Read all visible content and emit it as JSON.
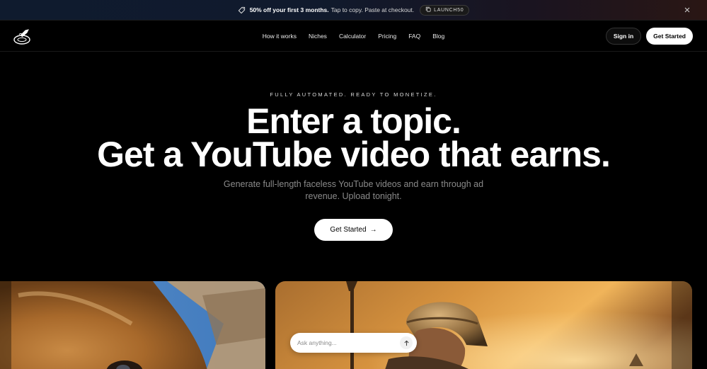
{
  "banner": {
    "offer": "50% off your first 3 months.",
    "instructions": "Tap to copy. Paste at checkout.",
    "code": "LAUNCH50"
  },
  "nav": {
    "links": [
      "How it works",
      "Niches",
      "Calculator",
      "Pricing",
      "FAQ",
      "Blog"
    ],
    "sign_in": "Sign in",
    "get_started": "Get Started"
  },
  "hero": {
    "eyebrow": "FULLY AUTOMATED. READY TO MONETIZE.",
    "headline_line1": "Enter a topic.",
    "headline_line2": "Get a YouTube video that earns.",
    "subtitle_line1": "Generate full-length faceless YouTube videos and earn through ad",
    "subtitle_line2": "revenue. Upload tonight.",
    "cta": "Get Started",
    "cta_arrow": "→"
  },
  "ask": {
    "placeholder": "Ask anything..."
  },
  "colors": {
    "background": "#000000",
    "button_light": "#ffffff",
    "subtitle": "#8a8a8a"
  }
}
